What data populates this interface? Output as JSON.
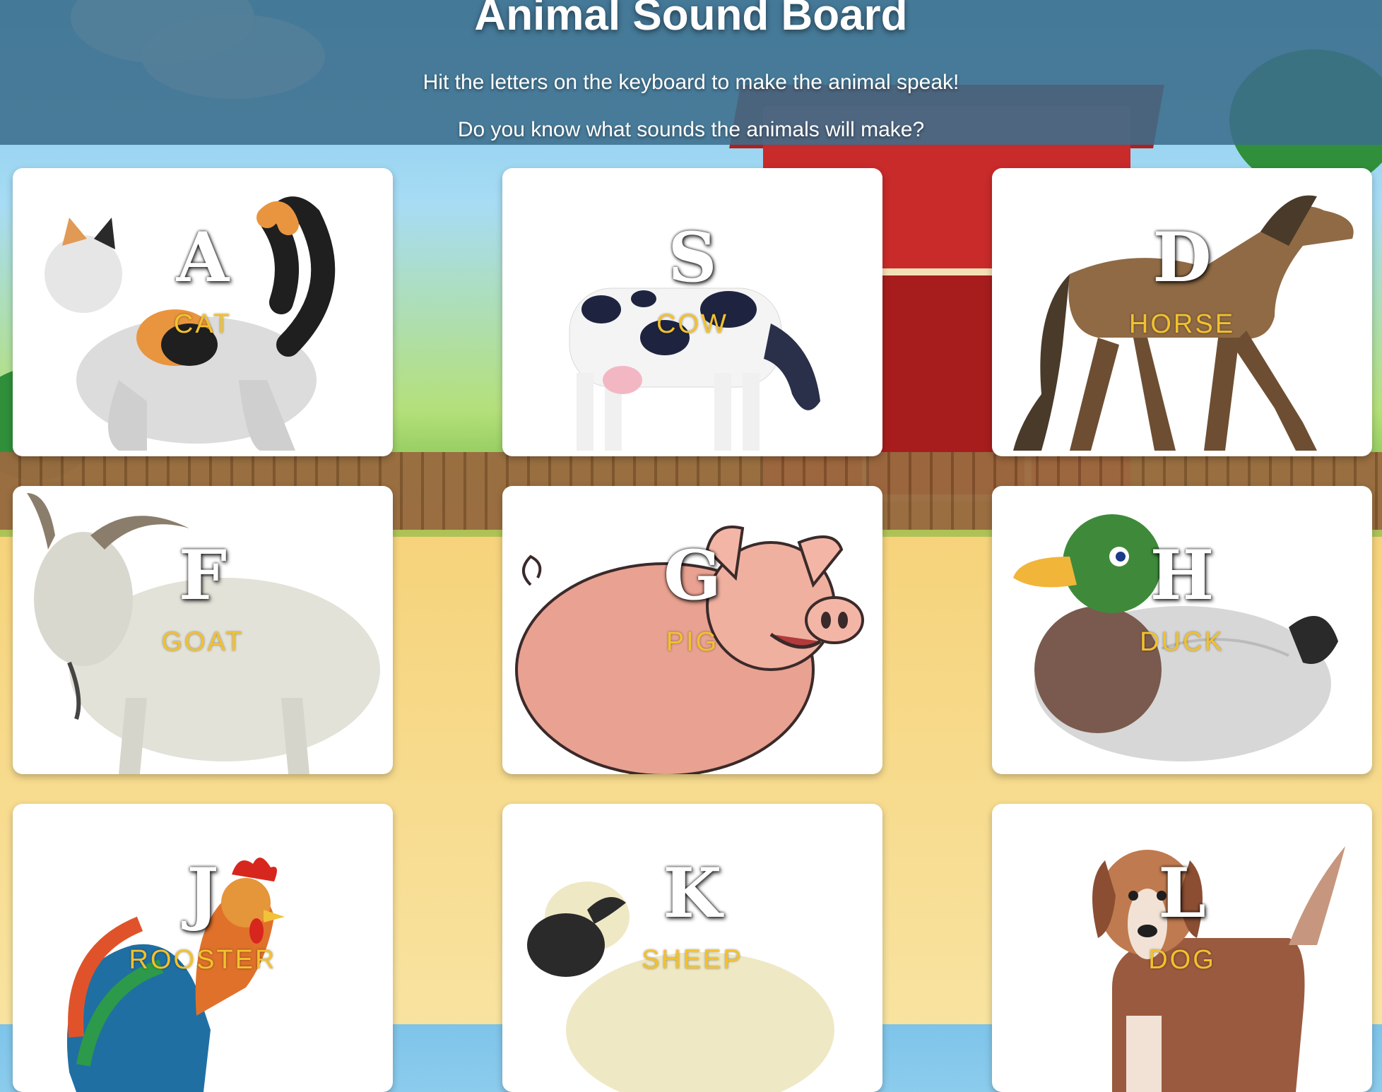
{
  "header": {
    "title": "Animal Sound Board",
    "subtitle1": "Hit the letters on the keyboard to make the animal speak!",
    "subtitle2": "Do you know what sounds the animals will make?"
  },
  "cards": [
    {
      "key": "A",
      "animal": "CAT",
      "icon": "cat-image"
    },
    {
      "key": "S",
      "animal": "COW",
      "icon": "cow-image"
    },
    {
      "key": "D",
      "animal": "HORSE",
      "icon": "horse-image"
    },
    {
      "key": "F",
      "animal": "GOAT",
      "icon": "goat-image"
    },
    {
      "key": "G",
      "animal": "PIG",
      "icon": "pig-image"
    },
    {
      "key": "H",
      "animal": "DUCK",
      "icon": "duck-image"
    },
    {
      "key": "J",
      "animal": "ROOSTER",
      "icon": "rooster-image"
    },
    {
      "key": "K",
      "animal": "SHEEP",
      "icon": "sheep-image"
    },
    {
      "key": "L",
      "animal": "DOG",
      "icon": "dog-image"
    }
  ],
  "colors": {
    "header_bg": "#3c6e8c",
    "label": "#f2c12e",
    "card_bg": "#ffffff"
  }
}
